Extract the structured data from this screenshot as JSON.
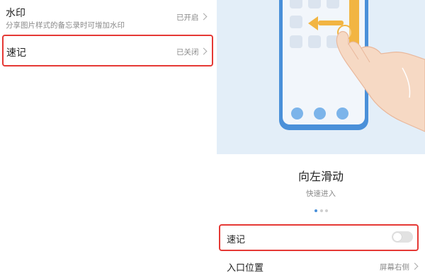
{
  "left": {
    "watermark": {
      "title": "水印",
      "subtitle": "分享图片样式的备忘录时可增加水印",
      "value": "已开启"
    },
    "quicknote": {
      "title": "速记",
      "value": "已关闭"
    }
  },
  "right": {
    "gesture": {
      "title": "向左滑动",
      "subtitle": "快速进入"
    },
    "quicknote_toggle": {
      "label": "速记",
      "state": "off"
    },
    "entry_position": {
      "label": "入口位置",
      "value": "屏幕右侧"
    }
  },
  "colors": {
    "highlight": "#e53935",
    "accent": "#4a90d9",
    "illustration_bg": "#e3eef8",
    "arrow": "#f2b542"
  }
}
